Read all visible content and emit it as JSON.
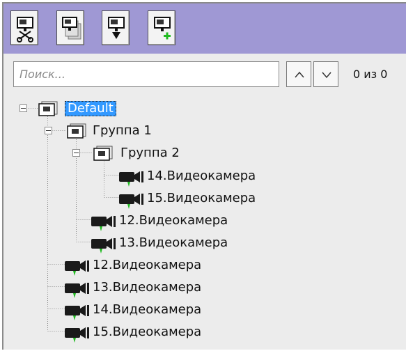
{
  "toolbar": {
    "buttons": [
      {
        "icon": "camera-cut-icon"
      },
      {
        "icon": "camera-stack-icon"
      },
      {
        "icon": "camera-move-down-icon"
      },
      {
        "icon": "camera-add-icon"
      }
    ]
  },
  "search": {
    "placeholder": "Поиск...",
    "value": "",
    "prev_icon": "chevron-up-icon",
    "next_icon": "chevron-down-icon",
    "counter": "0 из 0"
  },
  "tree": {
    "root": {
      "label": "Default",
      "type": "group",
      "expanded": true,
      "selected": true
    },
    "group1": {
      "label": "Группа 1",
      "type": "group",
      "expanded": true
    },
    "group2": {
      "label": "Группа 2",
      "type": "group",
      "expanded": true
    },
    "g2_cam14": {
      "label": "14.Видеокамера",
      "type": "camera"
    },
    "g2_cam15": {
      "label": "15.Видеокамера",
      "type": "camera"
    },
    "g1_cam12": {
      "label": "12.Видеокамера",
      "type": "camera"
    },
    "g1_cam13": {
      "label": "13.Видеокамера",
      "type": "camera"
    },
    "cam12": {
      "label": "12.Видеокамера",
      "type": "camera"
    },
    "cam13": {
      "label": "13.Видеокамера",
      "type": "camera"
    },
    "cam14": {
      "label": "14.Видеокамера",
      "type": "camera"
    },
    "cam15": {
      "label": "15.Видеокамера",
      "type": "camera"
    }
  },
  "colors": {
    "toolbar_bg": "#9f98d4",
    "selection": "#3399ff",
    "camera_status": "#22bb22"
  }
}
